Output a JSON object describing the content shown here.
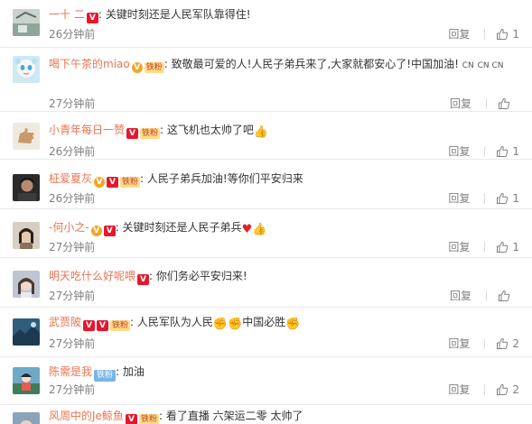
{
  "comments": [
    {
      "user": "一十 二",
      "text": "关键时刻还是人民军队靠得住!",
      "time": "26分钟前",
      "reply": "回复",
      "likes": "1"
    },
    {
      "user": "喝下午茶的miao",
      "member_badge": "铁粉",
      "text": "致敬最可爱的人!人民子弟兵来了,大家就都安心了!中国加油!",
      "cn_tags": [
        "CN",
        "CN CN"
      ],
      "time": "27分钟前",
      "reply": "回复",
      "likes": ""
    },
    {
      "user": "小青年每日一赞",
      "member_badge": "铁粉",
      "text": "这飞机也太帅了吧",
      "time": "26分钟前",
      "reply": "回复",
      "likes": "1"
    },
    {
      "user": "柾爱夏灰",
      "member_badge": "铁粉",
      "text": "人民子弟兵加油!等你们平安归来",
      "time": "26分钟前",
      "reply": "回复",
      "likes": "1"
    },
    {
      "user": "-何小之-",
      "text": "关键时刻还是人民子弟兵",
      "time": "27分钟前",
      "reply": "回复",
      "likes": "1"
    },
    {
      "user": "明天吃什么好呢喂",
      "text": "你们务必平安归来!",
      "time": "27分钟前",
      "reply": "回复",
      "likes": ""
    },
    {
      "user": "武贾陂",
      "member_badge": "铁粉",
      "text_a": "人民军队为人民",
      "text_b": "中国必胜",
      "time": "27分钟前",
      "reply": "回复",
      "likes": "2"
    },
    {
      "user": "陈需是我",
      "fan_badge": "铁粉",
      "text": "加油",
      "time": "27分钟前",
      "reply": "回复",
      "likes": "2"
    },
    {
      "user": "风周中的Je鲸鱼",
      "member_badge": "铁粉",
      "text": "看了直播 六架运二零 太帅了"
    }
  ],
  "icons": {
    "verified": "V",
    "vip": "V",
    "like": "thumbs-up-outline-icon"
  },
  "colors": {
    "username": "#eb7350",
    "meta": "#808080",
    "verified_badge": "#f4a525",
    "vip_badge": "#e6162d"
  }
}
